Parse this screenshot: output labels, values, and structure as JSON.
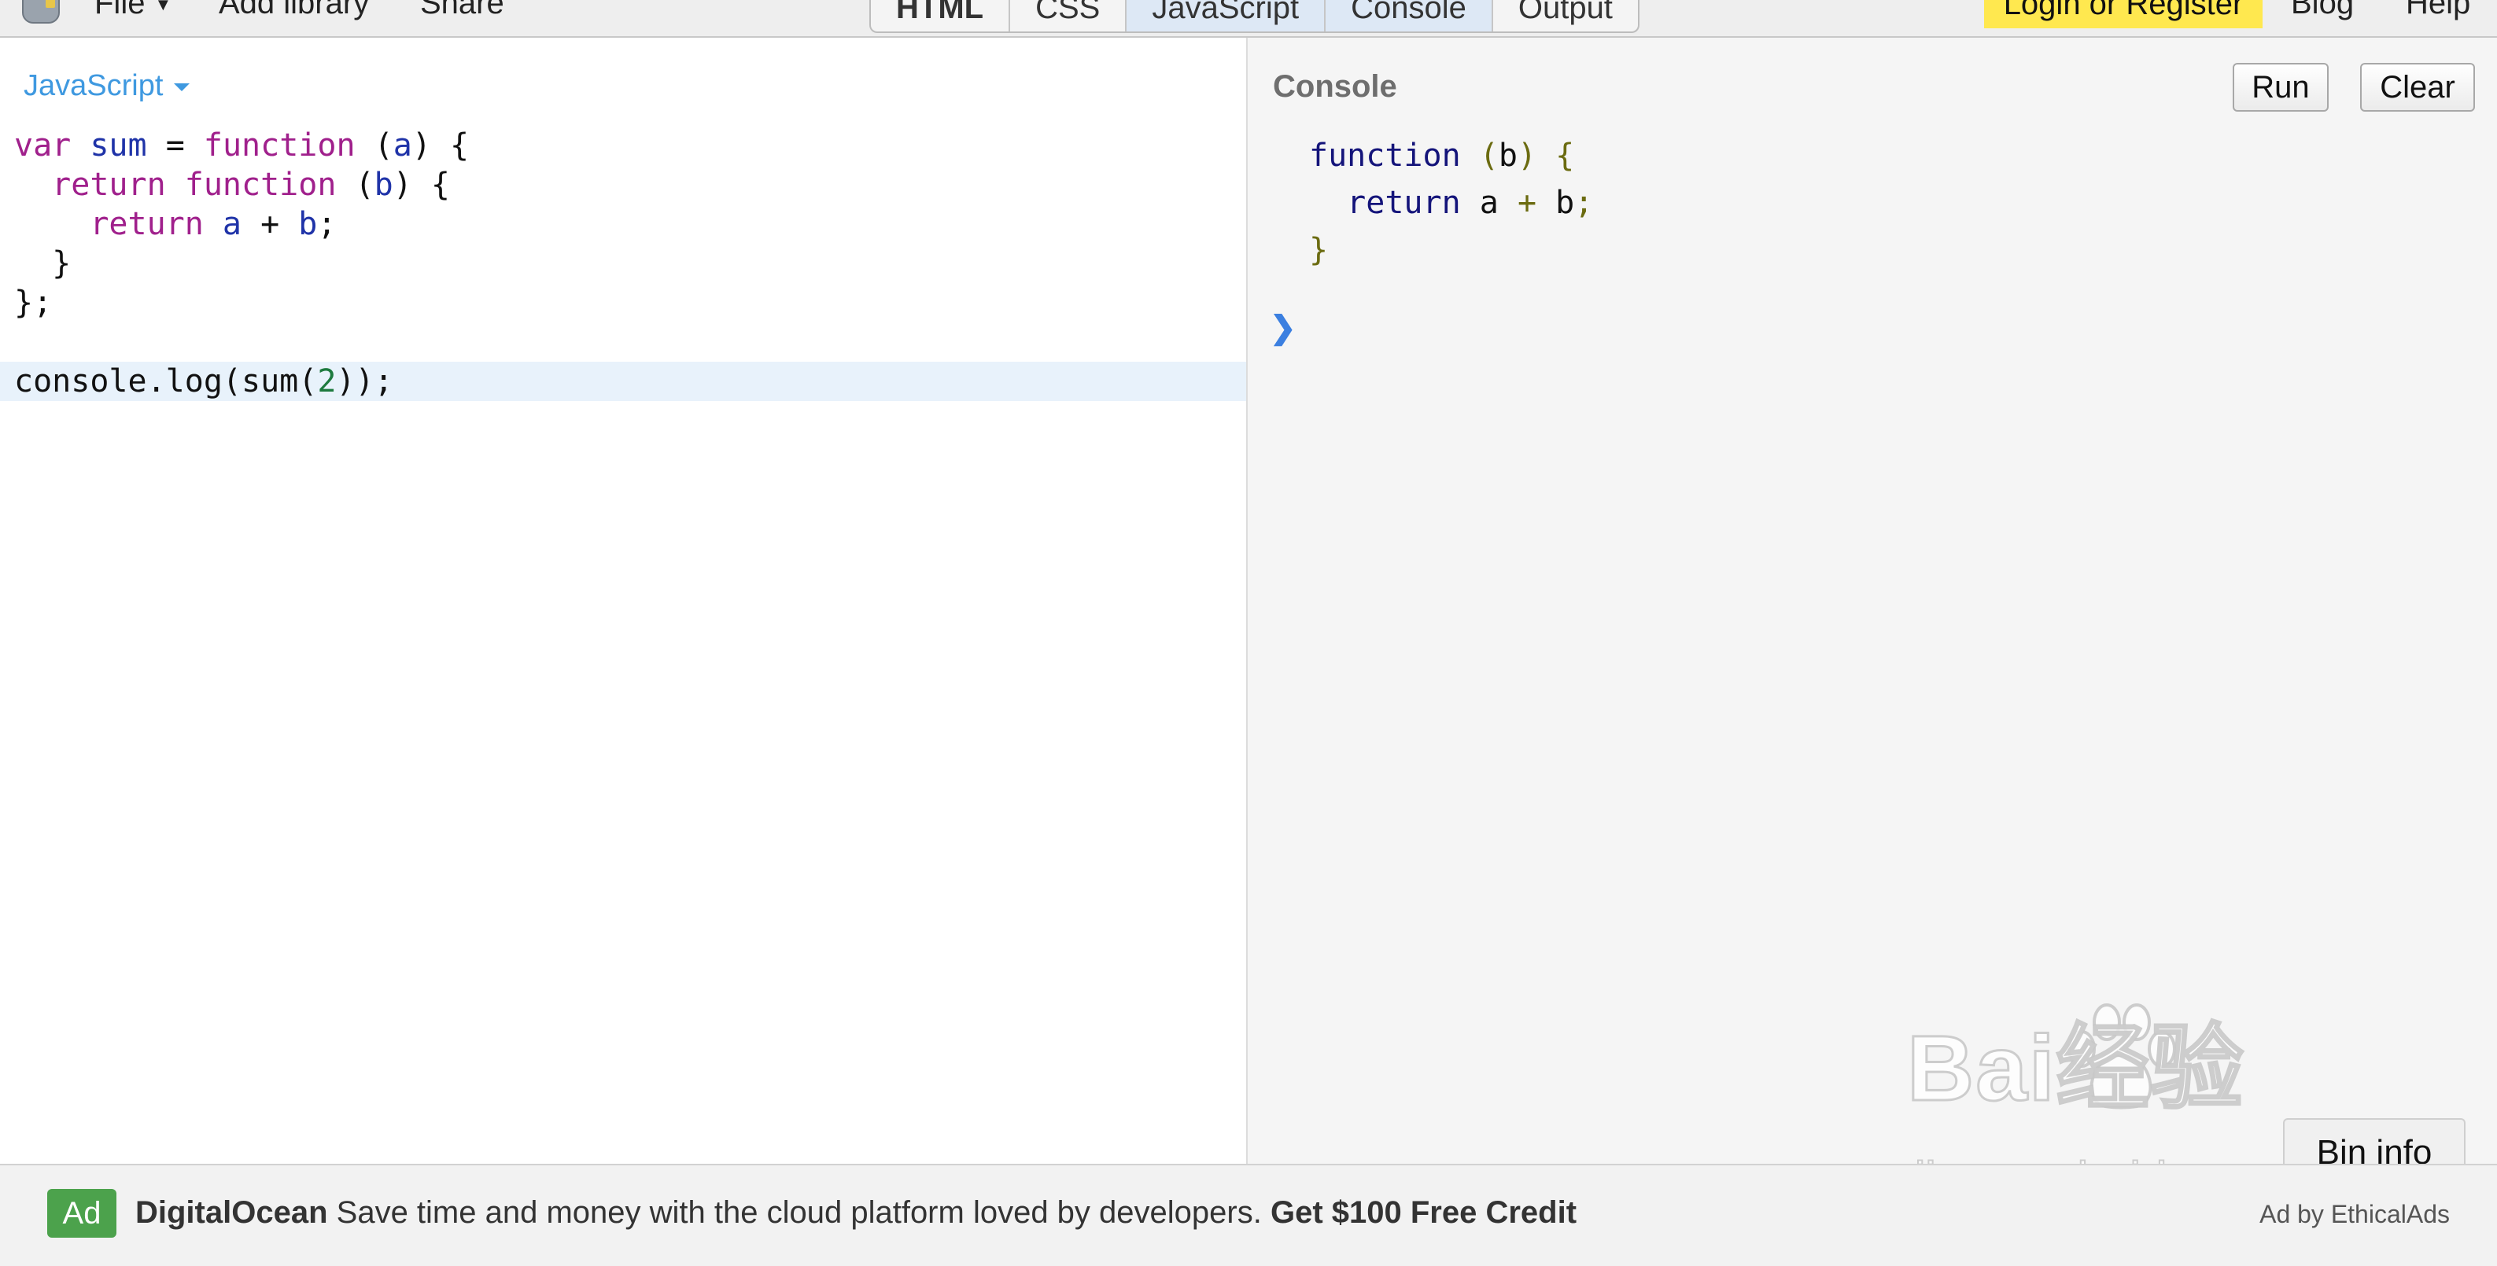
{
  "topbar": {
    "file": "File",
    "add_library": "Add library",
    "share": "Share",
    "tabs": [
      {
        "label": "HTML"
      },
      {
        "label": "CSS"
      },
      {
        "label": "JavaScript"
      },
      {
        "label": "Console"
      },
      {
        "label": "Output"
      }
    ],
    "login": "Login or Register",
    "blog": "Blog",
    "help": "Help"
  },
  "editor": {
    "language": "JavaScript",
    "lines": [
      "var sum = function (a) {",
      "  return function (b) {",
      "    return a + b;",
      "  }",
      "};",
      "",
      "console.log(sum(2));"
    ]
  },
  "console": {
    "title": "Console",
    "run": "Run",
    "clear": "Clear",
    "output": [
      "function (b) {",
      "  return a + b;",
      "}"
    ],
    "prompt": "❯",
    "bin_info": "Bin info"
  },
  "watermark": {
    "text": "Bai经验",
    "url": "jingyan.baidu.com"
  },
  "ad": {
    "badge": "Ad",
    "brand": "DigitalOcean",
    "text": "Save time and money with the cloud platform loved by developers.",
    "cta": "Get $100 Free Credit",
    "by": "Ad by EthicalAds"
  },
  "colors": {
    "accent_blue": "#3f99e0",
    "login_yellow": "#ffe84f",
    "ad_green": "#4ca24c"
  }
}
